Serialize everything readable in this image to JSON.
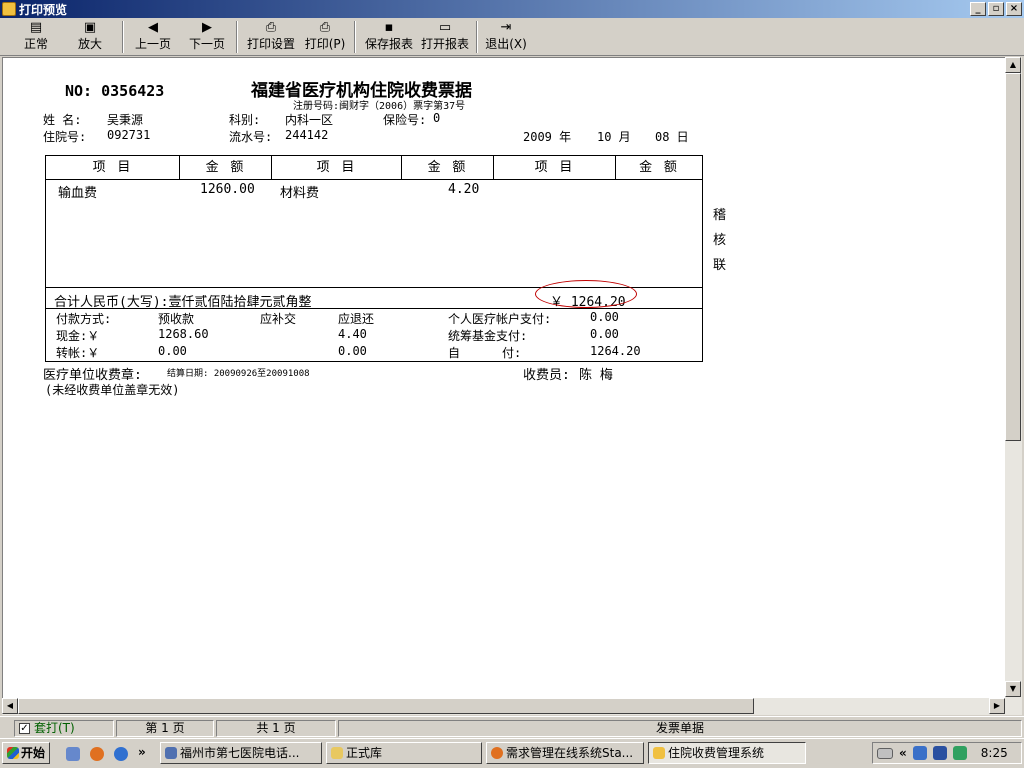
{
  "window": {
    "title": "打印预览",
    "min": "_",
    "restore": "▫",
    "close": "×"
  },
  "toolbar": {
    "normal": "正常",
    "zoom": "放大",
    "prev": "上一页",
    "next": "下一页",
    "print_setup": "打印设置",
    "print": "打印(P)",
    "save_report": "保存报表",
    "open_report": "打开报表",
    "exit": "退出(X)"
  },
  "receipt": {
    "no": "NO: 0356423",
    "title": "福建省医疗机构住院收费票据",
    "subtitle": "注册号码:闽财字（2006）票字第37号",
    "name_label": "姓  名:",
    "name": "吴秉源",
    "dept_label": "科别:",
    "dept": "内科一区",
    "insurance_label": "保险号:",
    "insurance": "0",
    "inpatient_label": "住院号:",
    "inpatient": "092731",
    "serial_label": "流水号:",
    "serial": "244142",
    "year": "2009 年",
    "month": "10 月",
    "day": "08 日",
    "col_item": "项  目",
    "col_amount": "金  额",
    "items": [
      {
        "name": "输血费",
        "amount": "1260.00"
      },
      {
        "name": "材料费",
        "amount": "4.20"
      }
    ],
    "side_mark": [
      "稽",
      "核",
      "联"
    ],
    "total_label": "合计人民币(大写):壹仟贰佰陆拾肆元贰角整",
    "total_amount": "￥ 1264.20",
    "pay_method": "付款方式:",
    "prepaid": "预收款",
    "supplement": "应补交",
    "refund": "应退还",
    "personal_account": "个人医疗帐户支付:",
    "personal_value": "0.00",
    "cash_label": "现金:￥",
    "cash_prepaid": "1268.60",
    "cash_refund": "4.40",
    "fund_label": "统筹基金支付:",
    "fund_value": "0.00",
    "transfer_label": "转帐:￥",
    "transfer_prepaid": "0.00",
    "transfer_refund": "0.00",
    "self_label": "自",
    "self_label2": "付:",
    "self_value": "1264.20",
    "seal_label": "医疗单位收费章:",
    "settle_period": "结算日期: 20090926至20091008",
    "cashier_label": "收费员:",
    "cashier": "陈  梅",
    "note": "(未经收费单位盖章无效)"
  },
  "status": {
    "checkbox": "套打(T)",
    "page": "第 1 页",
    "total": "共 1 页",
    "doc": "发票单据"
  },
  "taskbar": {
    "start": "开始",
    "more": "»",
    "tasks": [
      "福州市第七医院电话...",
      "正式库",
      "需求管理在线系统Sta...",
      "住院收费管理系统"
    ],
    "tray_arrow": "«",
    "clock": "8:25"
  },
  "colors": {
    "title_start": "#0a246a",
    "title_end": "#a6caf0",
    "stamp": "#c00000"
  }
}
